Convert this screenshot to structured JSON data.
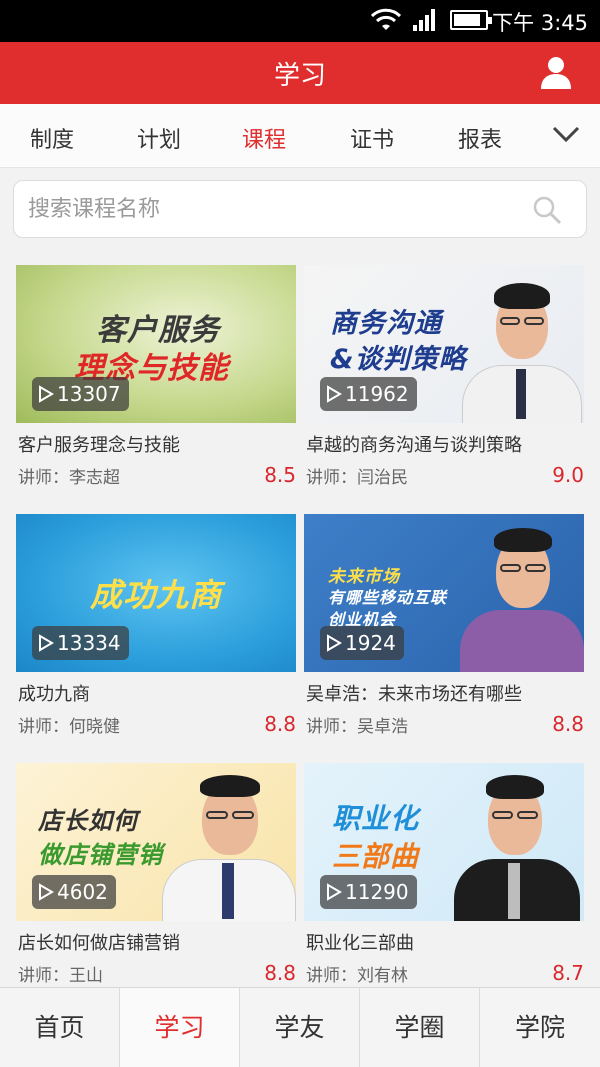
{
  "status_bar": {
    "time": "下午 3:45",
    "icons": [
      "wifi-icon",
      "signal-icon",
      "battery-icon"
    ]
  },
  "header": {
    "title": "学习",
    "user_icon": "user-icon"
  },
  "tabs": [
    {
      "label": "制度",
      "active": false
    },
    {
      "label": "计划",
      "active": false
    },
    {
      "label": "课程",
      "active": true
    },
    {
      "label": "证书",
      "active": false
    },
    {
      "label": "报表",
      "active": false
    }
  ],
  "tabs_more_icon": "chevron-down-icon",
  "search": {
    "placeholder": "搜索课程名称",
    "value": "",
    "icon": "search-icon"
  },
  "courses": [
    {
      "thumb_line1": "客户服务",
      "thumb_line2": "理念与技能",
      "plays": "13307",
      "title": "客户服务理念与技能",
      "lecturer": "讲师：李志超",
      "score": "8.5"
    },
    {
      "thumb_line1": "商务沟通",
      "thumb_line2": "&谈判策略",
      "plays": "11962",
      "title": "卓越的商务沟通与谈判策略",
      "lecturer": "讲师：闫治民",
      "score": "9.0"
    },
    {
      "thumb_line1": "成功九商",
      "thumb_line2": "",
      "plays": "13334",
      "title": "成功九商",
      "lecturer": "讲师：何晓健",
      "score": "8.8"
    },
    {
      "thumb_line1": "未来市场",
      "thumb_line2": "有哪些移动互联",
      "thumb_line3": "创业机会",
      "plays": "1924",
      "title": "吴卓浩：未来市场还有哪些",
      "lecturer": "讲师：吴卓浩",
      "score": "8.8"
    },
    {
      "thumb_line1": "店长如何",
      "thumb_line2": "做店铺营销",
      "plays": "4602",
      "title": "店长如何做店铺营销",
      "lecturer": "讲师：王山",
      "score": "8.8"
    },
    {
      "thumb_line1": "职业化",
      "thumb_line2": "三部曲",
      "plays": "11290",
      "title": "职业化三部曲",
      "lecturer": "讲师：刘有林",
      "score": "8.7"
    }
  ],
  "bottom_nav": [
    {
      "label": "首页",
      "active": false
    },
    {
      "label": "学习",
      "active": true
    },
    {
      "label": "学友",
      "active": false
    },
    {
      "label": "学圈",
      "active": false
    },
    {
      "label": "学院",
      "active": false
    }
  ],
  "colors": {
    "brand_red": "#e02d2d",
    "score_red": "#d8282d"
  }
}
